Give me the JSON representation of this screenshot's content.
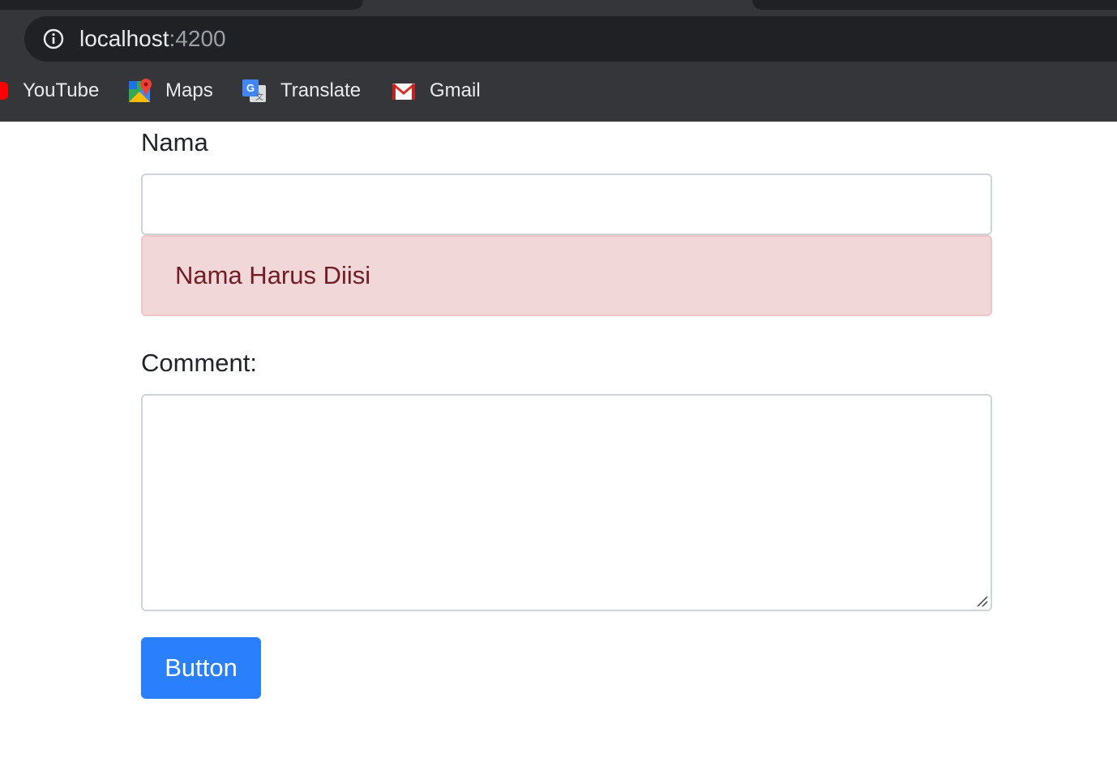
{
  "browser": {
    "url_host": "localhost",
    "url_port": ":4200",
    "bookmarks": [
      {
        "label": "YouTube",
        "icon": "youtube-icon"
      },
      {
        "label": "Maps",
        "icon": "maps-icon"
      },
      {
        "label": "Translate",
        "icon": "translate-icon"
      },
      {
        "label": "Gmail",
        "icon": "gmail-icon"
      }
    ]
  },
  "form": {
    "nama_label": "Nama",
    "nama_value": "",
    "nama_error": "Nama Harus Diisi",
    "comment_label": "Comment:",
    "comment_value": "",
    "submit_label": "Button"
  },
  "colors": {
    "chrome_bg": "#35363a",
    "omnibox_bg": "#202124",
    "alert_bg": "#f2d7d9",
    "alert_text": "#721c24",
    "button_bg": "#2a7ffc"
  }
}
